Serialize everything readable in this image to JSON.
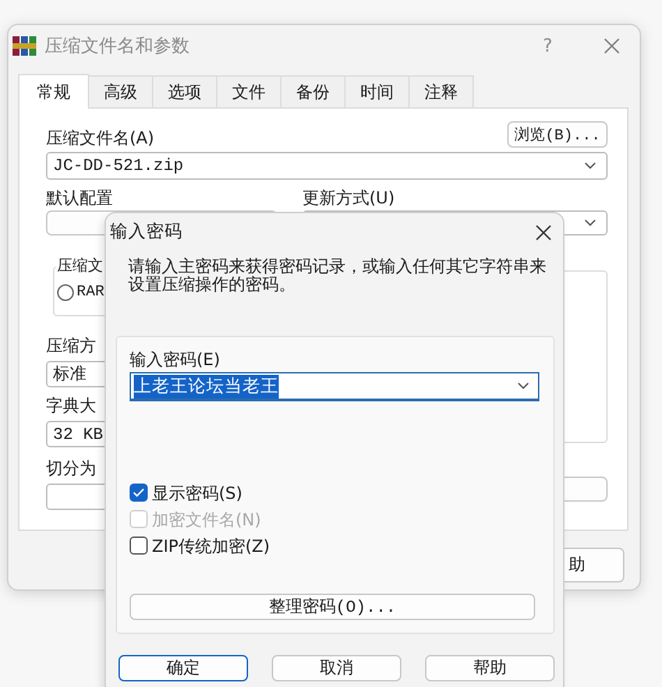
{
  "background_window": {
    "title": "压缩文件名和参数",
    "help_button": "?",
    "tabs": [
      {
        "label": "常规",
        "selected": true
      },
      {
        "label": "高级",
        "selected": false
      },
      {
        "label": "选项",
        "selected": false
      },
      {
        "label": "文件",
        "selected": false
      },
      {
        "label": "备份",
        "selected": false
      },
      {
        "label": "时间",
        "selected": false
      },
      {
        "label": "注释",
        "selected": false
      }
    ],
    "browse_button": "浏览(B)...",
    "archive_name_label": "压缩文件名(A)",
    "archive_name": "JC-DD-521.zip",
    "profiles_label": "默认配置",
    "update_mode_label": "更新方式(U)",
    "format_group_label": "压缩文",
    "format_options": [
      {
        "label": "RAR",
        "selected": false
      }
    ],
    "method_label": "压缩方",
    "method": "标准",
    "dictionary_label": "字典大",
    "dictionary": "32 KB",
    "split_label": "切分为",
    "help_button_partial": "助"
  },
  "password_dialog": {
    "title": "输入密码",
    "description": "请输入主密码来获得密码记录，或输入任何其它字符串来设置压缩操作的密码。",
    "password_label": "输入密码(E)",
    "password": "上老王论坛当老王",
    "options": [
      {
        "label": "显示密码(S)",
        "checked": true,
        "disabled": false
      },
      {
        "label": "加密文件名(N)",
        "checked": false,
        "disabled": true
      },
      {
        "label": "ZIP传统加密(Z)",
        "checked": false,
        "disabled": false
      }
    ],
    "organize_button": "整理密码(O)...",
    "buttons": [
      {
        "label": "确定",
        "default": true
      },
      {
        "label": "取消",
        "default": false
      },
      {
        "label": "帮助",
        "default": false
      }
    ]
  }
}
